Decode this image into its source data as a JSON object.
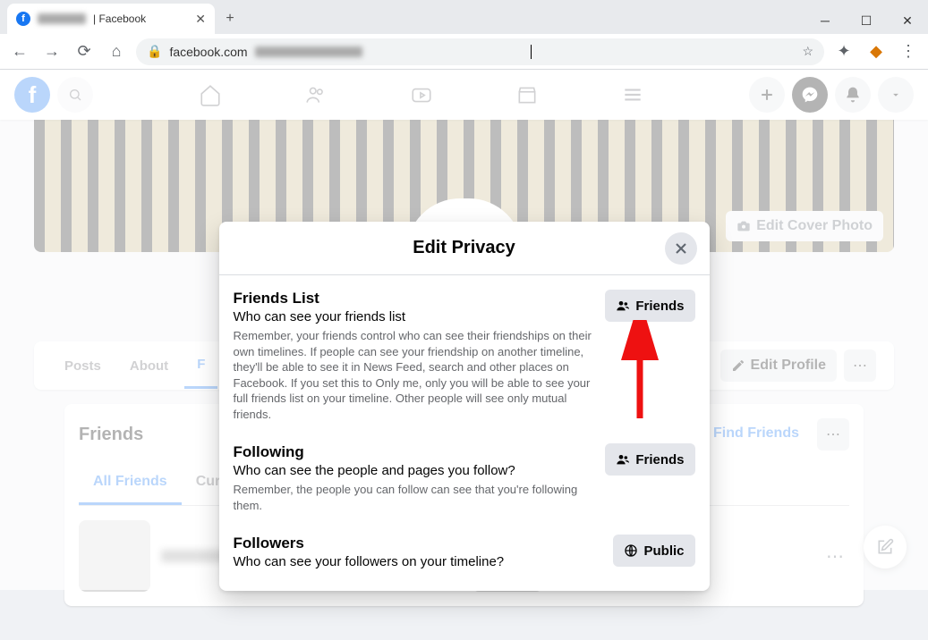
{
  "browser": {
    "tab_title": "| Facebook",
    "url": "facebook.com"
  },
  "profile": {
    "edit_cover": "Edit Cover Photo",
    "tabs": [
      "Posts",
      "About",
      "F"
    ],
    "edit_profile": "Edit Profile"
  },
  "friends_card": {
    "title": "Friends",
    "find_friends": "Find Friends",
    "tabs": [
      "All Friends",
      "Curr"
    ]
  },
  "modal": {
    "title": "Edit Privacy",
    "sections": [
      {
        "title": "Friends List",
        "subtitle": "Who can see your friends list",
        "help": "Remember, your friends control who can see their friendships on their own timelines. If people can see your friendship on another timeline, they'll be able to see it in News Feed, search and other places on Facebook. If you set this to Only me, only you will be able to see your full friends list on your timeline. Other people will see only mutual friends.",
        "audience": "Friends",
        "audience_icon": "friends"
      },
      {
        "title": "Following",
        "subtitle": "Who can see the people and pages you follow?",
        "help": "Remember, the people you can follow can see that you're following them.",
        "audience": "Friends",
        "audience_icon": "friends"
      },
      {
        "title": "Followers",
        "subtitle": "Who can see your followers on your timeline?",
        "help": "",
        "audience": "Public",
        "audience_icon": "public"
      }
    ]
  }
}
